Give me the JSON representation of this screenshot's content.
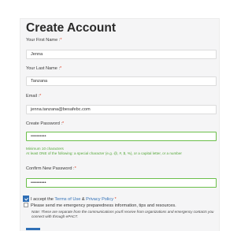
{
  "form": {
    "title": "Create Account",
    "required_marker": "*",
    "first_name": {
      "label": "Your First Name :",
      "value": "Jenna"
    },
    "last_name": {
      "label": "Your Last Name :",
      "value": "Tanzana"
    },
    "email": {
      "label": "Email :",
      "value": "jenna.tanzana@besafebc.com"
    },
    "password": {
      "label": "Create Password :",
      "value": "••••••••••"
    },
    "password_hints": {
      "min": "Minimum 10 characters",
      "special": "At least ONE of the following: a special character (e.g. @, #, $, %), or a capital letter, or a number"
    },
    "confirm_password": {
      "label": "Confirm New Password :",
      "value": "••••••••••"
    },
    "terms": {
      "prefix": "I accept the ",
      "terms_link": "Terms of Use",
      "amp": " & ",
      "privacy_link": "Privacy Policy",
      "suffix": " *",
      "checked": true
    },
    "emergency_optin": {
      "label": "Please send me emergency preparedness information, tips and resources.",
      "checked": false
    },
    "note": "Note: These are separate from the communications you'll receive from organizations and emergency contacts you connect with through ePACT."
  },
  "colors": {
    "accent": "#2f6fb6",
    "required": "#e0492e",
    "valid": "#6bbf4a",
    "hint": "#56a83a"
  }
}
